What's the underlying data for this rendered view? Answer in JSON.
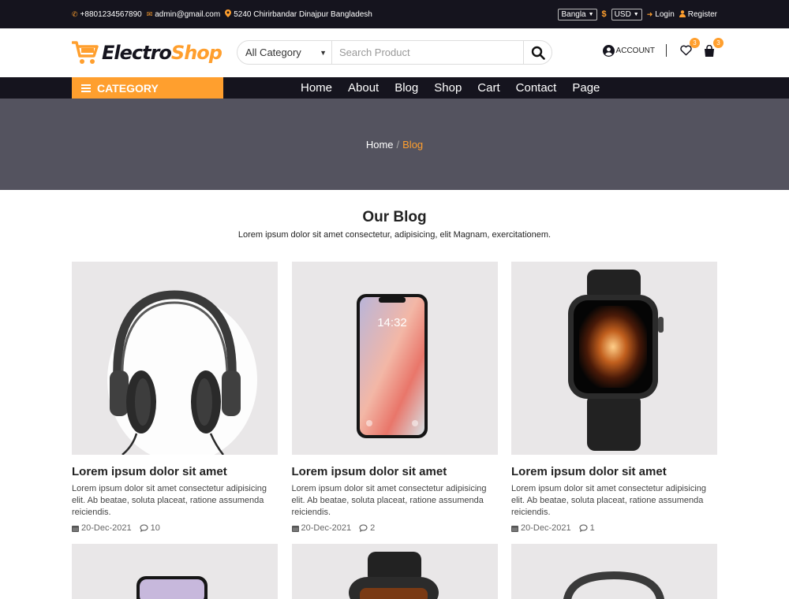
{
  "topbar": {
    "phone": "+8801234567890",
    "email": "admin@gmail.com",
    "address": "5240 Chirirbandar Dinajpur Bangladesh",
    "language": "Bangla",
    "currency_symbol": "$",
    "currency": "USD",
    "login": "Login",
    "register": "Register"
  },
  "header": {
    "logo_part1": "Electro",
    "logo_part2": "Shop",
    "category_select": "All Category",
    "search_placeholder": "Search Product",
    "account": "ACCOUNT",
    "wishlist_count": "3",
    "cart_count": "3"
  },
  "nav": {
    "category_label": "CATEGORY",
    "links": [
      "Home",
      "About",
      "Blog",
      "Shop",
      "Cart",
      "Contact",
      "Page"
    ]
  },
  "breadcrumb": {
    "home": "Home",
    "separator": "/",
    "current": "Blog"
  },
  "blog": {
    "title": "Our Blog",
    "subtitle": "Lorem ipsum dolor sit amet consectetur, adipisicing, elit Magnam, exercitationem.",
    "posts": [
      {
        "image": "headphones",
        "title": "Lorem ipsum dolor sit amet",
        "excerpt": "Lorem ipsum dolor sit amet consectetur adipisicing elit. Ab beatae, soluta placeat, ratione assumenda reiciendis.",
        "date": "20-Dec-2021",
        "comments": "10"
      },
      {
        "image": "smartphone",
        "title": "Lorem ipsum dolor sit amet",
        "excerpt": "Lorem ipsum dolor sit amet consectetur adipisicing elit. Ab beatae, soluta placeat, ratione assumenda reiciendis.",
        "date": "20-Dec-2021",
        "comments": "2"
      },
      {
        "image": "smartwatch",
        "title": "Lorem ipsum dolor sit amet",
        "excerpt": "Lorem ipsum dolor sit amet consectetur adipisicing elit. Ab beatae, soluta placeat, ratione assumenda reiciendis.",
        "date": "20-Dec-2021",
        "comments": "1"
      },
      {
        "image": "smartphone"
      },
      {
        "image": "smartwatch"
      },
      {
        "image": "headphones"
      }
    ]
  },
  "colors": {
    "accent": "#ff9f2e",
    "dark": "#15141e",
    "banner": "#54535f",
    "card_bg": "#e9e7e8"
  },
  "phone_screen": {
    "time": "14:32"
  }
}
